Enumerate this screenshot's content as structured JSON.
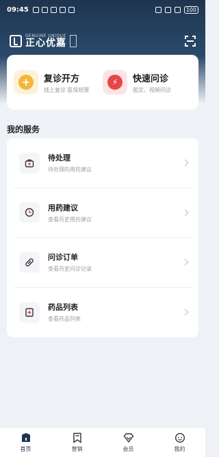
{
  "status_bar": {
    "time": "09:45",
    "battery": "100"
  },
  "header": {
    "logo_en": "GENUINE UNIQUE",
    "logo_cn": "正心优嘉",
    "logo_seal": "大药房"
  },
  "quick_actions": [
    {
      "title": "复诊开方",
      "subtitle": "线上复诊 医保结算",
      "icon": "plus-icon",
      "color": "#f3b63b"
    },
    {
      "title": "快速问诊",
      "subtitle": "图文、视频问诊",
      "icon": "lightning-icon",
      "color": "#e64646"
    }
  ],
  "services": {
    "section_title": "我的服务",
    "items": [
      {
        "title": "待处理",
        "subtitle": "待处理的用药建议",
        "icon": "medkit-icon"
      },
      {
        "title": "用药建议",
        "subtitle": "查看历史用药建议",
        "icon": "clock-icon"
      },
      {
        "title": "问诊订单",
        "subtitle": "查看历史问诊记录",
        "icon": "pill-icon"
      },
      {
        "title": "药品列表",
        "subtitle": "查看药品列表",
        "icon": "medicine-box-icon"
      }
    ]
  },
  "tabbar": {
    "items": [
      {
        "label": "首页",
        "icon": "home-icon",
        "active": true
      },
      {
        "label": "营销",
        "icon": "bookmark-icon",
        "active": false
      },
      {
        "label": "会员",
        "icon": "diamond-icon",
        "active": false
      },
      {
        "label": "我的",
        "icon": "profile-icon",
        "active": false
      }
    ]
  },
  "colors": {
    "brand_dark": "#1e3550",
    "background": "#eef2f6",
    "card": "#ffffff"
  }
}
